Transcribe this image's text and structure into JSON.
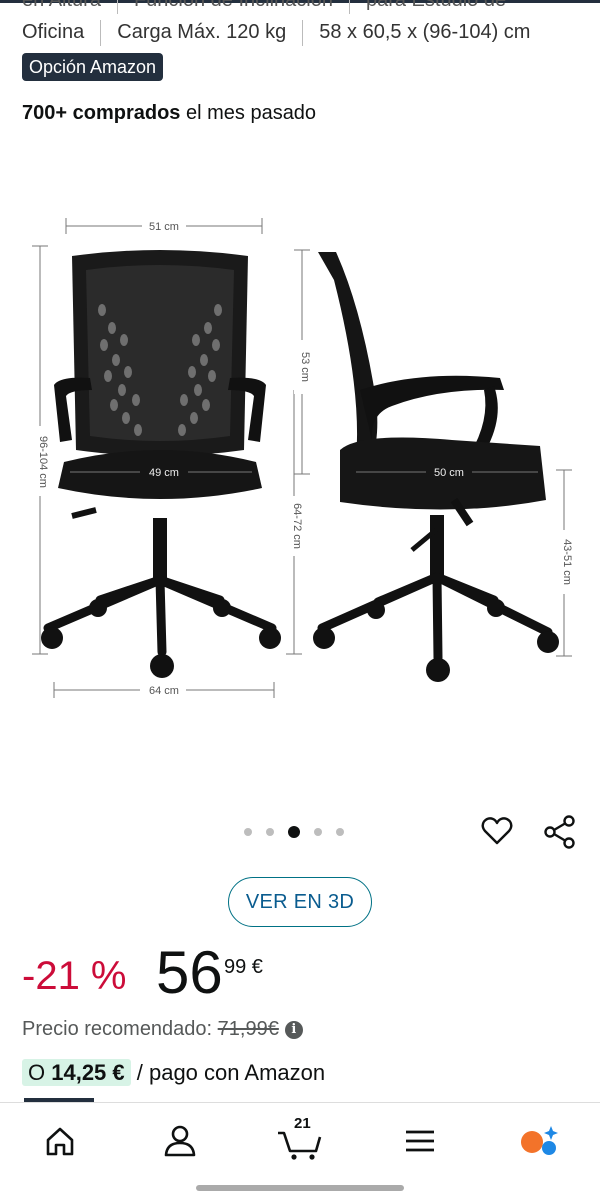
{
  "features": {
    "row1": [
      "en Altura",
      "Función de Inclinación",
      "para Estudio de"
    ],
    "row2": [
      "Oficina",
      "Carga Máx. 120 kg",
      "58 x 60,5 x (96-104) cm"
    ]
  },
  "badge": "Opción Amazon",
  "bought": {
    "bold": "700+ comprados",
    "rest": " el mes pasado"
  },
  "dimensions": {
    "width_top": "51 cm",
    "height_total": "96-104 cm",
    "seat_width": "49 cm",
    "back_height": "53 cm",
    "arm_height": "64-72 cm",
    "seat_depth": "50 cm",
    "seat_height": "43-51 cm",
    "base_width": "64 cm"
  },
  "carousel": {
    "count": 5,
    "active_index": 2
  },
  "view3d_label": "VER EN 3D",
  "price": {
    "discount": "-21 %",
    "whole": "56",
    "fraction": "99 €",
    "rrp_label": "Precio recomendado: ",
    "rrp_value": "71,99€",
    "info": "i"
  },
  "payment": {
    "prefix": "O ",
    "amount": "14,25 €",
    "rest": " / pago con Amazon"
  },
  "nav": {
    "items": [
      "home-icon",
      "account-icon",
      "cart-icon",
      "menu-icon",
      "rufus-icon"
    ],
    "cart_count": "21"
  },
  "colors": {
    "discount": "#cc0c39",
    "button_border": "#007185",
    "pay_pill": "#d7f3e6",
    "dark": "#232f3e"
  }
}
